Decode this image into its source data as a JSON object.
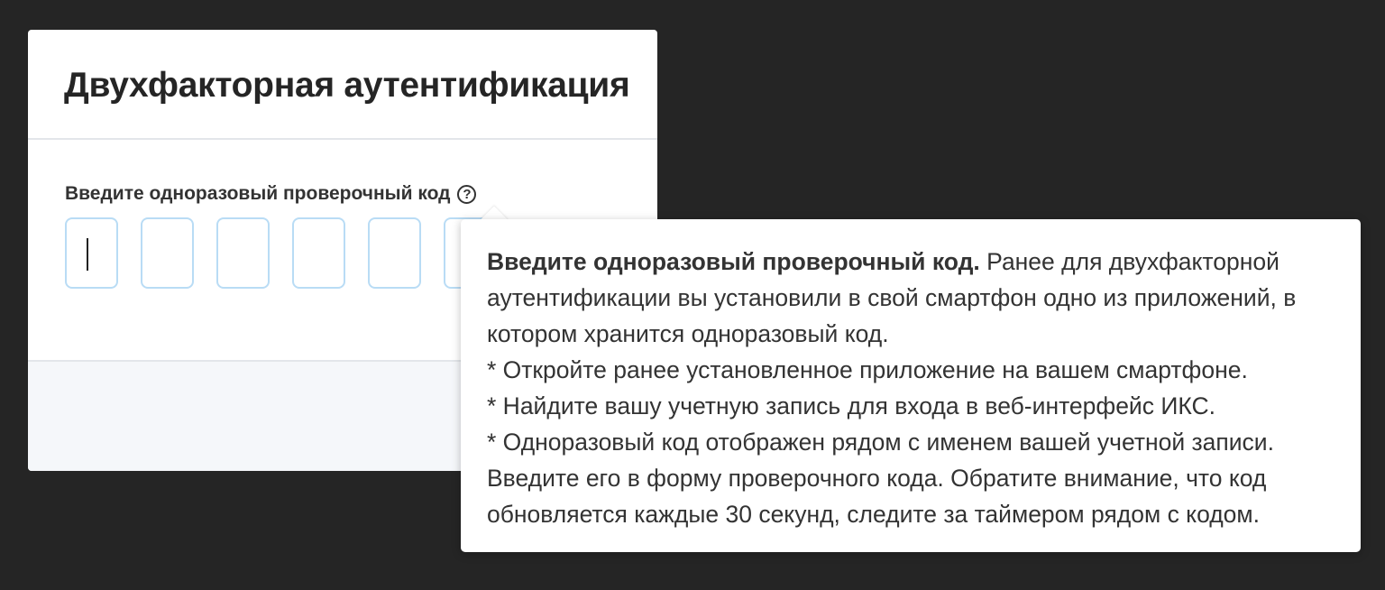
{
  "dialog": {
    "title": "Двухфакторная аутентификация",
    "code_label": "Введите одноразовый проверочный код",
    "help_icon": "question-circle-icon",
    "code_digits": [
      "",
      "",
      "",
      "",
      "",
      ""
    ]
  },
  "tooltip": {
    "heading": "Введите одноразовый проверочный код.",
    "lead": " Ранее для двухфакторной аутентификации вы установили в свой смартфон одно из приложений, в котором хранится одноразовый код.",
    "steps": [
      "* Откройте ранее установленное приложение на вашем смартфоне.",
      "* Найдите вашу учетную запись для входа в веб-интерфейс ИКС.",
      "* Одноразовый код отображен рядом с именем вашей учетной записи."
    ],
    "note": "Введите его в форму проверочного кода. Обратите внимание, что код обновляется каждые 30 секунд, следите за таймером рядом с кодом."
  },
  "colors": {
    "background": "#252525",
    "input_border": "#b9dcf5",
    "footer_bg": "#f5f7fa"
  }
}
